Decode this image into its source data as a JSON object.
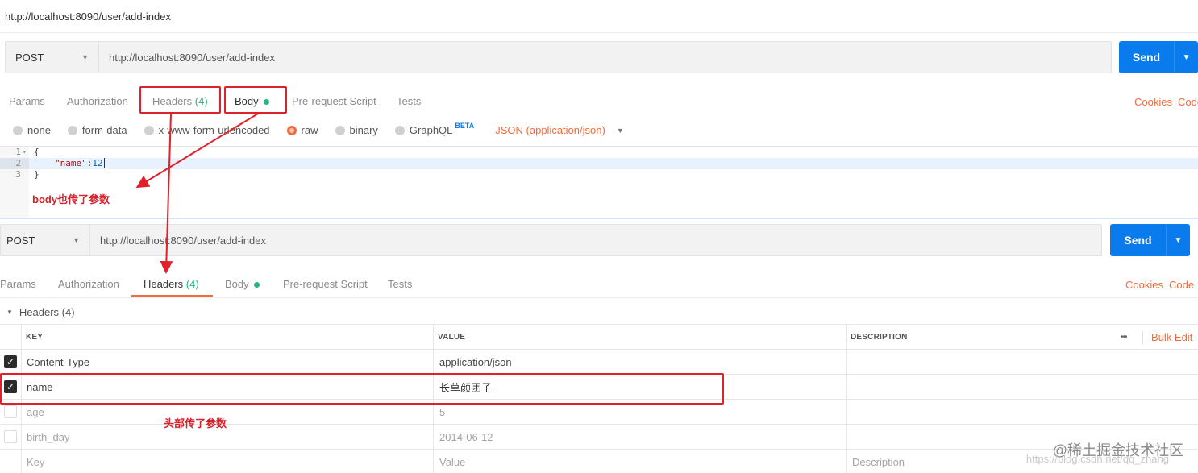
{
  "window_title": "http://localhost:8090/user/add-index",
  "top_request": {
    "method": "POST",
    "url": "http://localhost:8090/user/add-index",
    "send_label": "Send",
    "tabs": {
      "params": "Params",
      "authorization": "Authorization",
      "headers": "Headers",
      "headers_count": "(4)",
      "body": "Body",
      "pre_request": "Pre-request Script",
      "tests": "Tests"
    },
    "cookies": "Cookies",
    "code": "Code",
    "body_modes": [
      "none",
      "form-data",
      "x-www-form-urlencoded",
      "raw",
      "binary",
      "GraphQL"
    ],
    "beta": "BETA",
    "selected_mode": "raw",
    "content_type": "JSON (application/json)",
    "code_lines": [
      {
        "num": "1",
        "text": "{"
      },
      {
        "num": "2",
        "key": "\"name\"",
        "sep": ":",
        "val": "12"
      },
      {
        "num": "3",
        "text": "}"
      }
    ]
  },
  "annotations": {
    "body": "body也传了参数",
    "headers": "头部传了参数"
  },
  "bottom_request": {
    "method": "POST",
    "url": "http://localhost:8090/user/add-index",
    "send_label": "Send",
    "tabs": {
      "params": "Params",
      "authorization": "Authorization",
      "headers": "Headers",
      "headers_count": "(4)",
      "body": "Body",
      "pre_request": "Pre-request Script",
      "tests": "Tests"
    },
    "cookies": "Cookies",
    "code": "Code",
    "headers_section_title": "Headers (4)",
    "columns": {
      "key": "KEY",
      "value": "VALUE",
      "description": "DESCRIPTION"
    },
    "more": "•••",
    "bulk_edit": "Bulk Edit",
    "rows": [
      {
        "checked": true,
        "key": "Content-Type",
        "value": "application/json"
      },
      {
        "checked": true,
        "key": "name",
        "value": "长草颜团子"
      },
      {
        "checked": false,
        "key": "age",
        "value": "5"
      },
      {
        "checked": false,
        "key": "birth_day",
        "value": "2014-06-12"
      }
    ],
    "placeholder": {
      "key": "Key",
      "value": "Value",
      "description": "Description"
    }
  },
  "watermark": "@稀土掘金技术社区",
  "watermark_url": "https://blog.csdn.net/qq_zhang"
}
